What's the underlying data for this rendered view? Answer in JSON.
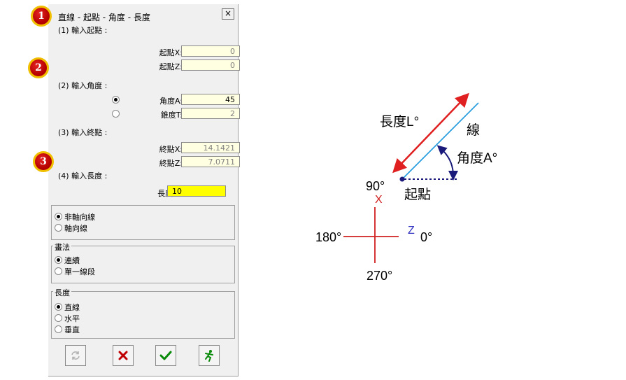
{
  "dialog": {
    "title": "直線 - 起點 - 角度 - 長度",
    "close_glyph": "×",
    "section1": "(1) 輸入起點 :",
    "start_x_label": "起點X:",
    "start_x_value": "0",
    "start_z_label": "起點Z:",
    "start_z_value": "0",
    "section2": "(2) 輸入角度 :",
    "angle_label": "角度A:",
    "angle_value": "45",
    "taper_label": "錐度T:",
    "taper_value": "2",
    "section3": "(3) 輸入終點 :",
    "end_x_label": "終點X:",
    "end_x_value": "14.1421",
    "end_z_label": "終點Z:",
    "end_z_value": "7.0711",
    "section4": "(4) 輸入長度 :",
    "length_label": "長度L:",
    "length_value": "10",
    "axis_group": {
      "options": [
        "非軸向線",
        "軸向線"
      ],
      "selected": 0
    },
    "draw_group": {
      "title": "畫法",
      "options": [
        "連續",
        "單一線段"
      ],
      "selected": 0
    },
    "length_group": {
      "title": "長度",
      "options": [
        "直線",
        "水平",
        "垂直"
      ],
      "selected": 0
    }
  },
  "markers": [
    "1",
    "2",
    "3"
  ],
  "diagram": {
    "length_label": "長度L°",
    "line_label": "線",
    "angle_label": "角度A°",
    "start_label": "起點",
    "angle_90": "90°",
    "angle_180": "180°",
    "angle_0": "0°",
    "angle_270": "270°",
    "x_axis": "X",
    "z_axis": "Z"
  },
  "colors": {
    "field_bg": "#ffffe1",
    "length_field_bg": "#ffff00",
    "arrow_red": "#e02020",
    "line_blue": "#2b9fe0",
    "angle_navy": "#1a1a7a",
    "axis_red": "#d02020",
    "z_blue": "#3030c0"
  }
}
